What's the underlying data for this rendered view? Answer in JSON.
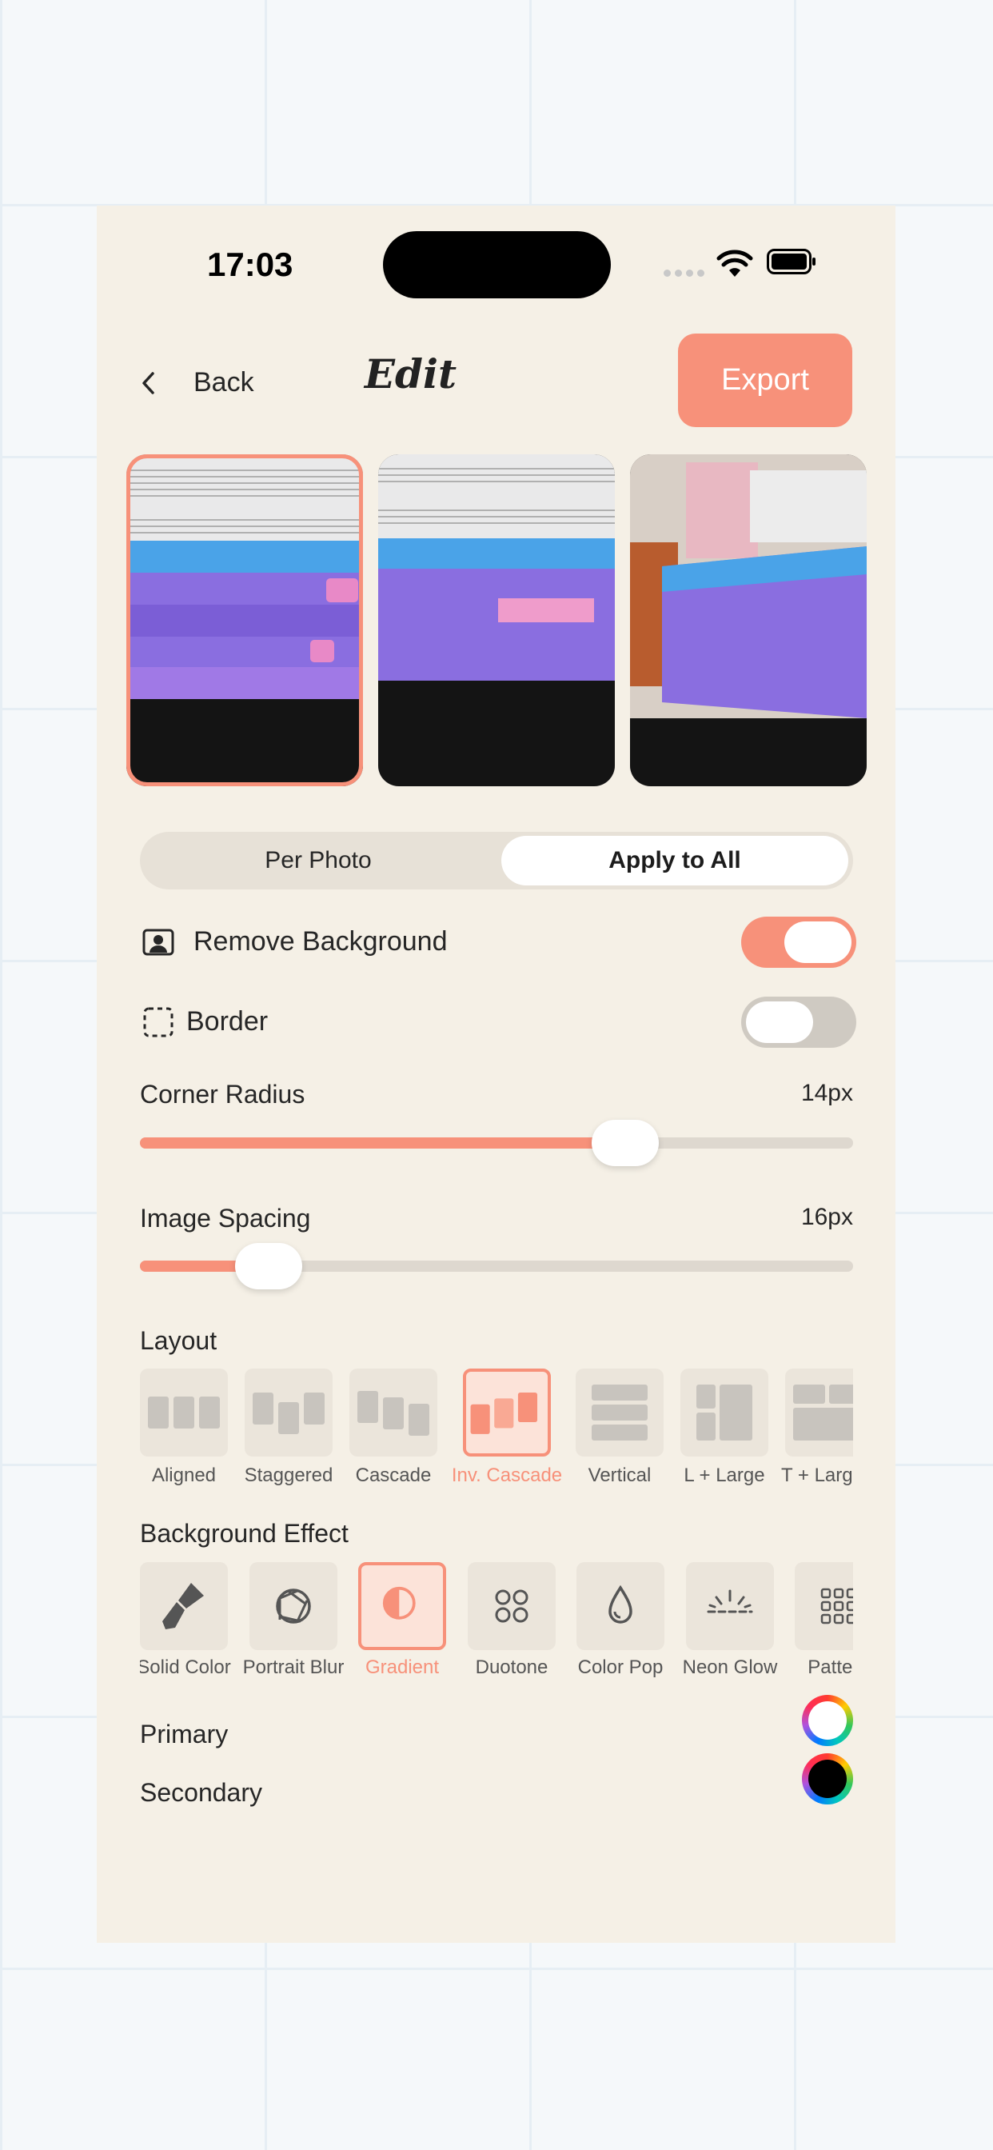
{
  "status": {
    "time": "17:03"
  },
  "nav": {
    "back_label": "Back",
    "title": "Edit",
    "export_label": "Export"
  },
  "segment": {
    "per_photo": "Per Photo",
    "apply_all": "Apply to All",
    "selected": "Apply to All"
  },
  "options": {
    "remove_bg": {
      "label": "Remove Background",
      "enabled": true
    },
    "border": {
      "label": "Border",
      "enabled": false
    }
  },
  "sliders": {
    "corner_radius": {
      "label": "Corner Radius",
      "value": "14px",
      "fraction": 0.68
    },
    "image_spacing": {
      "label": "Image Spacing",
      "value": "16px",
      "fraction": 0.18
    }
  },
  "layout": {
    "title": "Layout",
    "items": [
      {
        "label": "Aligned",
        "icon": "aligned-layout-icon"
      },
      {
        "label": "Staggered",
        "icon": "staggered-layout-icon"
      },
      {
        "label": "Cascade",
        "icon": "cascade-layout-icon"
      },
      {
        "label": "Inv. Cascade",
        "icon": "inverse-cascade-layout-icon",
        "selected": true
      },
      {
        "label": "Vertical",
        "icon": "vertical-layout-icon"
      },
      {
        "label": "L + Large",
        "icon": "left-large-layout-icon"
      },
      {
        "label": "T + Large",
        "icon": "top-large-layout-icon"
      }
    ]
  },
  "effects": {
    "title": "Background Effect",
    "items": [
      {
        "label": "Solid Color",
        "icon": "paint-brush-icon"
      },
      {
        "label": "Portrait Blur",
        "icon": "aperture-icon"
      },
      {
        "label": "Gradient",
        "icon": "half-circle-icon",
        "selected": true
      },
      {
        "label": "Duotone",
        "icon": "four-circles-icon"
      },
      {
        "label": "Color Pop",
        "icon": "drop-icon"
      },
      {
        "label": "Neon Glow",
        "icon": "sunrise-icon"
      },
      {
        "label": "Pattern",
        "icon": "grid-dots-icon"
      }
    ]
  },
  "colors": {
    "primary": {
      "label": "Primary",
      "value": "#ffffff"
    },
    "secondary": {
      "label": "Secondary",
      "value": "#000000"
    }
  },
  "theme": {
    "accent": "#f7917a",
    "panel": "#f5f0e6"
  }
}
